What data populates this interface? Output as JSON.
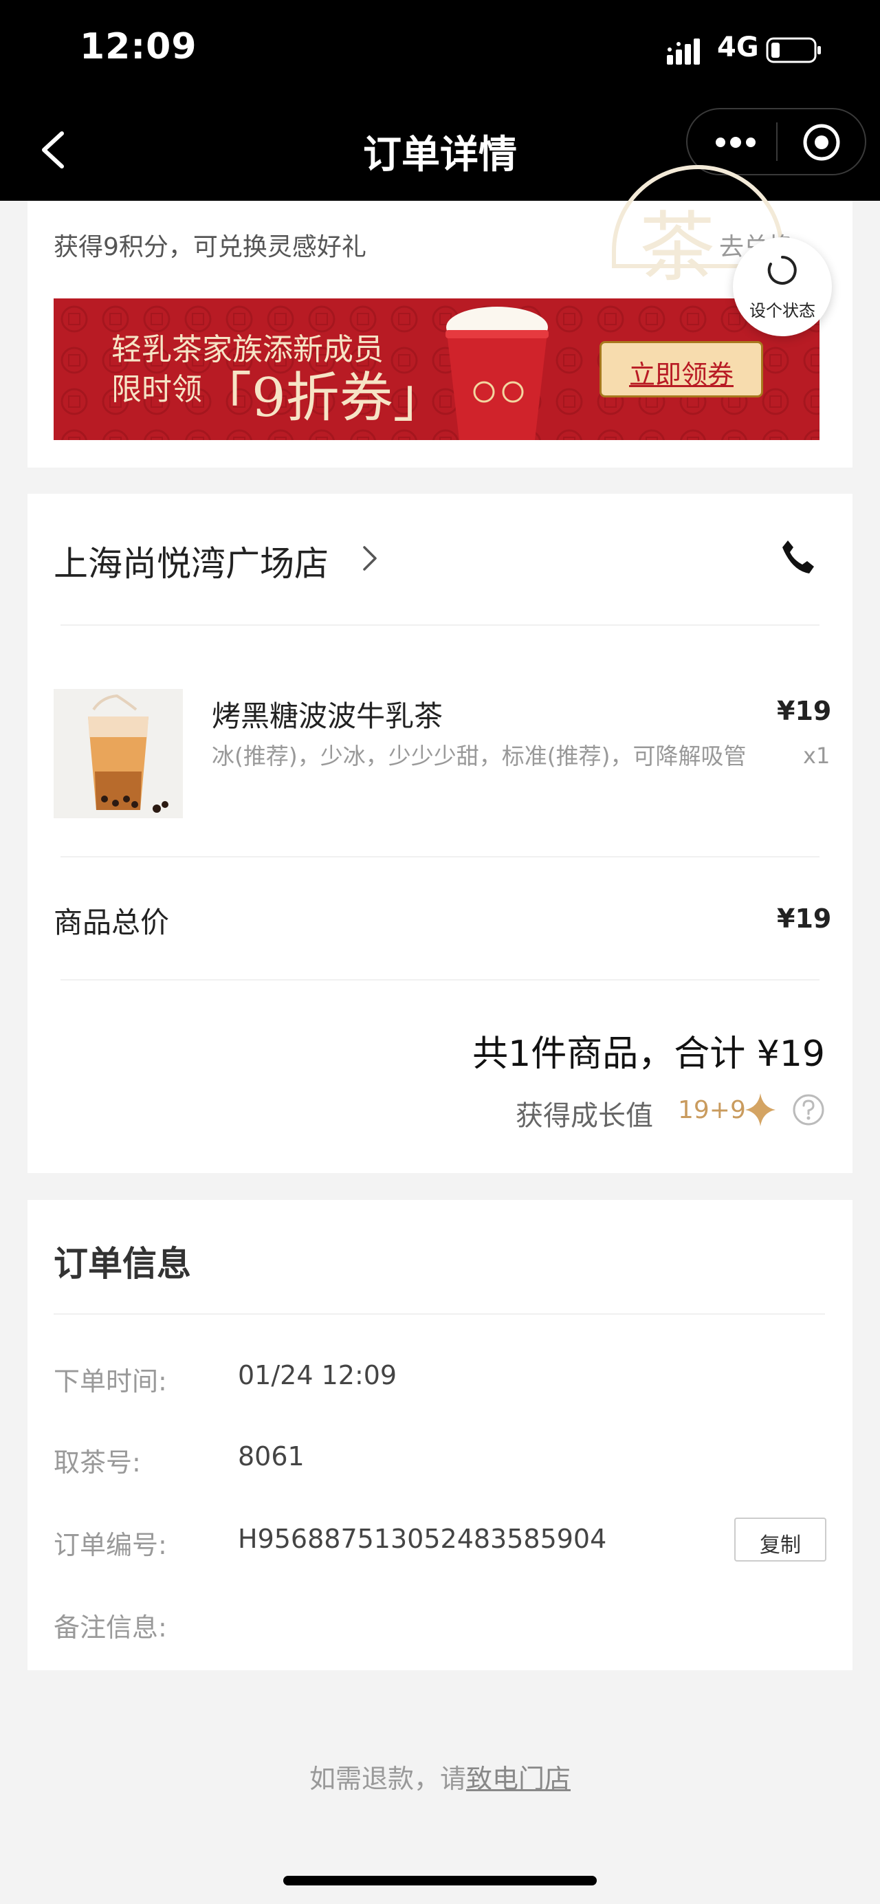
{
  "status_bar": {
    "time": "12:09",
    "network": "4G"
  },
  "nav": {
    "title": "订单详情"
  },
  "points": {
    "text": "获得9积分，可兑换灵感好礼",
    "link": "去兑换 ›"
  },
  "watermark": {
    "char": "茶"
  },
  "state_button": {
    "label": "设个状态"
  },
  "banner": {
    "line1": "轻乳茶家族添新成员",
    "line2_prefix": "限时领",
    "line2_highlight": "「9折券」",
    "button": "立即领券",
    "bg_color": "#b81b24"
  },
  "store": {
    "name": "上海尚悦湾广场店"
  },
  "product": {
    "name": "烤黑糖波波牛乳茶",
    "options": "冰(推荐)，少冰，少少少甜，标准(推荐)，可降解吸管",
    "price": "¥19",
    "quantity": "x1"
  },
  "subtotal": {
    "label": "商品总价",
    "value": "¥19"
  },
  "total": {
    "text": "共1件商品，合计 ¥19"
  },
  "growth": {
    "label": "获得成长值",
    "value": "19+9",
    "accent": "#c99b5e"
  },
  "order_info": {
    "title": "订单信息",
    "time_label": "下单时间:",
    "time_value": "01/24 12:09",
    "pickup_label": "取茶号:",
    "pickup_value": "8061",
    "order_no_label": "订单编号:",
    "order_no_value": "H956887513052483585904",
    "note_label": "备注信息:",
    "copy_button": "复制"
  },
  "refund": {
    "prefix": "如需退款，请",
    "link": "致电门店"
  }
}
